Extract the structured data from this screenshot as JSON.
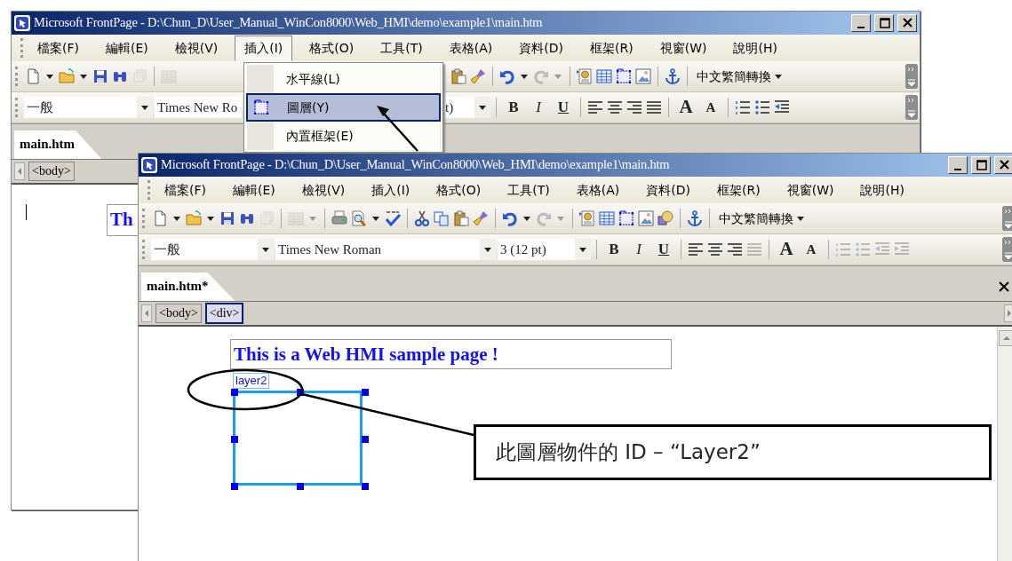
{
  "back_window": {
    "title": "Microsoft FrontPage - D:\\Chun_D\\User_Manual_WinCon8000\\Web_HMI\\demo\\example1\\main.htm",
    "menu": [
      {
        "label": "檔案(F)",
        "open": false
      },
      {
        "label": "編輯(E)",
        "open": false
      },
      {
        "label": "檢視(V)",
        "open": false
      },
      {
        "label": "插入(I)",
        "open": true
      },
      {
        "label": "格式(O)",
        "open": false
      },
      {
        "label": "工具(T)",
        "open": false
      },
      {
        "label": "表格(A)",
        "open": false
      },
      {
        "label": "資料(D)",
        "open": false
      },
      {
        "label": "框架(R)",
        "open": false
      },
      {
        "label": "視窗(W)",
        "open": false
      },
      {
        "label": "說明(H)",
        "open": false
      }
    ],
    "insert_menu": [
      {
        "label": "水平線(L)",
        "selected": false
      },
      {
        "label": "圖層(Y)",
        "selected": true
      },
      {
        "label": "內置框架(E)",
        "selected": false
      }
    ],
    "language_button": "中文繁簡轉換",
    "style_box": "一般",
    "font_box": "Times New Ro",
    "size_box": "t)",
    "format_buttons": [
      "B",
      "I",
      "U"
    ],
    "font_size_buttons": [
      "A",
      "A"
    ],
    "lists_enabled": true,
    "tab": "main.htm",
    "tags": [
      {
        "label": "<body>",
        "selected": false
      }
    ],
    "body_text": "Th"
  },
  "front_window": {
    "title": "Microsoft FrontPage - D:\\Chun_D\\User_Manual_WinCon8000\\Web_HMI\\demo\\example1\\main.htm",
    "menu": [
      {
        "label": "檔案(F)",
        "open": false
      },
      {
        "label": "編輯(E)",
        "open": false
      },
      {
        "label": "檢視(V)",
        "open": false
      },
      {
        "label": "插入(I)",
        "open": false
      },
      {
        "label": "格式(O)",
        "open": false
      },
      {
        "label": "工具(T)",
        "open": false
      },
      {
        "label": "表格(A)",
        "open": false
      },
      {
        "label": "資料(D)",
        "open": false
      },
      {
        "label": "框架(R)",
        "open": false
      },
      {
        "label": "視窗(W)",
        "open": false
      },
      {
        "label": "說明(H)",
        "open": false
      }
    ],
    "language_button": "中文繁簡轉換",
    "style_box": "一般",
    "font_box": "Times New Roman",
    "size_box": "3  (12 pt)",
    "format_buttons": [
      "B",
      "I",
      "U"
    ],
    "font_size_buttons": [
      "A",
      "A"
    ],
    "lists_enabled": false,
    "tab": "main.htm*",
    "tags": [
      {
        "label": "<body>",
        "selected": false
      },
      {
        "label": "<div>",
        "selected": true
      }
    ],
    "heading": "This is a Web HMI sample page !",
    "layer_label": "layer2"
  },
  "callout": {
    "text": "此圖層物件的 ID – “Layer2”"
  }
}
